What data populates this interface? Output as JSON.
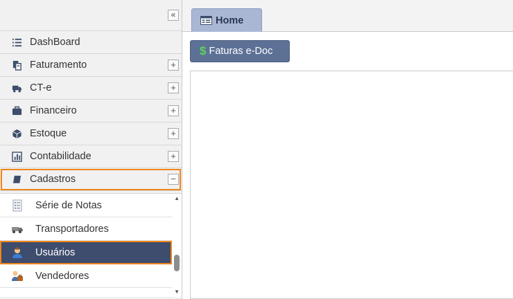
{
  "sidebar": {
    "collapse_label": "«",
    "items": [
      {
        "label": "DashBoard",
        "icon": "list-icon",
        "expand": ""
      },
      {
        "label": "Faturamento",
        "icon": "documents-icon",
        "expand": "+"
      },
      {
        "label": "CT-e",
        "icon": "truck-icon",
        "expand": "+"
      },
      {
        "label": "Financeiro",
        "icon": "briefcase-icon",
        "expand": "+"
      },
      {
        "label": "Estoque",
        "icon": "box-icon",
        "expand": "+"
      },
      {
        "label": "Contabilidade",
        "icon": "bar-chart-icon",
        "expand": "+"
      },
      {
        "label": "Cadastros",
        "icon": "book-icon",
        "expand": "−"
      }
    ],
    "submenu": [
      {
        "label": "Série de Notas",
        "icon": "notes-icon"
      },
      {
        "label": "Transportadores",
        "icon": "transport-icon"
      },
      {
        "label": "Usuários",
        "icon": "user-icon"
      },
      {
        "label": "Vendedores",
        "icon": "salesman-icon"
      }
    ],
    "scroll_up": "▲",
    "scroll_down": "▼"
  },
  "tabs": [
    {
      "label": "Home",
      "icon": "home-tab-icon"
    }
  ],
  "toolbar": {
    "faturas_label": "Faturas e-Doc",
    "faturas_icon": "$"
  },
  "colors": {
    "accent": "#3e4c6d",
    "highlight": "#f0861a",
    "button": "#5d7196",
    "tab": "#aab7d4"
  }
}
